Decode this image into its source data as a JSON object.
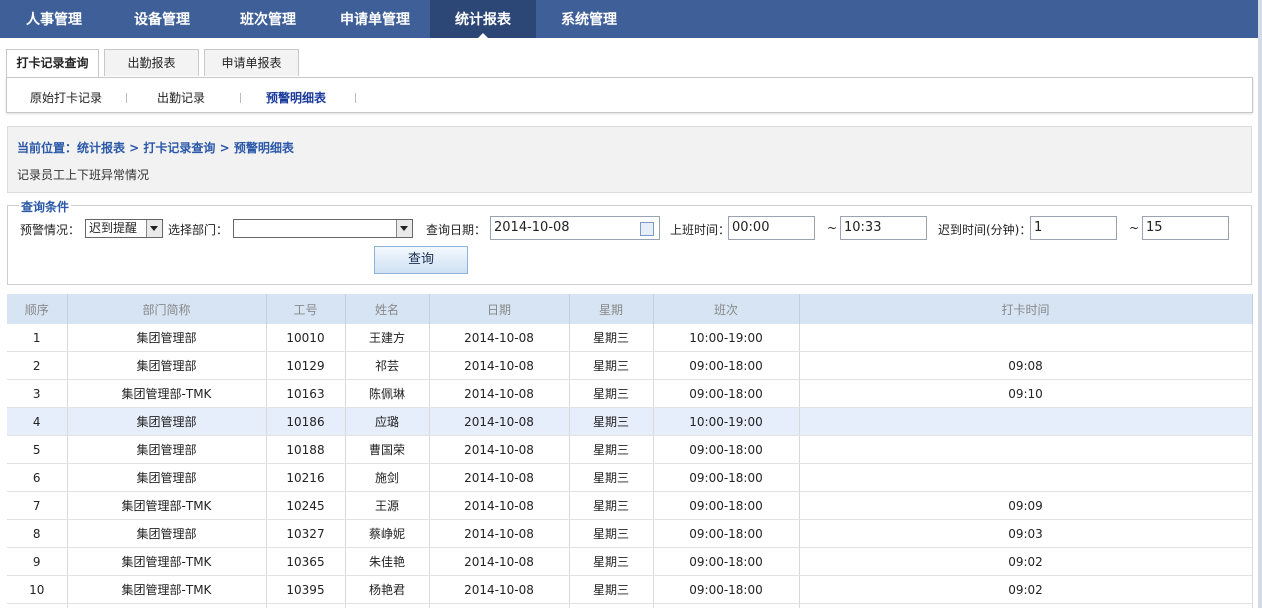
{
  "topnav": [
    "人事管理",
    "设备管理",
    "班次管理",
    "申请单管理",
    "统计报表",
    "系统管理"
  ],
  "subtabs": [
    "打卡记录查询",
    "出勤报表",
    "申请单报表"
  ],
  "subnav": [
    "原始打卡记录",
    "出勤记录",
    "预警明细表"
  ],
  "breadcrumb": "当前位置：统计报表 > 打卡记录查询 > 预警明细表",
  "description": "记录员工上下班异常情况",
  "query": {
    "legend": "查询条件",
    "warn_label": "预警情况：",
    "warn_value": "迟到提醒",
    "dept_label": "选择部门：",
    "dept_value": "",
    "date_label": "查询日期：",
    "date_value": "2014-10-08",
    "work_time_label": "上班时间：",
    "work_time_from": "00:00",
    "tilde": "~",
    "work_time_to": "10:33",
    "late_label": "迟到时间(分钟)：",
    "late_from": "1",
    "late_to": "15",
    "search_button": "查询"
  },
  "table": {
    "headers": [
      "顺序",
      "部门简称",
      "工号",
      "姓名",
      "日期",
      "星期",
      "班次",
      "打卡时间"
    ],
    "rows": [
      [
        "1",
        "集团管理部",
        "10010",
        "王建方",
        "2014-10-08",
        "星期三",
        "10:00-19:00",
        ""
      ],
      [
        "2",
        "集团管理部",
        "10129",
        "祁芸",
        "2014-10-08",
        "星期三",
        "09:00-18:00",
        "09:08"
      ],
      [
        "3",
        "集团管理部-TMK",
        "10163",
        "陈佩琳",
        "2014-10-08",
        "星期三",
        "09:00-18:00",
        "09:10"
      ],
      [
        "4",
        "集团管理部",
        "10186",
        "应璐",
        "2014-10-08",
        "星期三",
        "10:00-19:00",
        ""
      ],
      [
        "5",
        "集团管理部",
        "10188",
        "曹国荣",
        "2014-10-08",
        "星期三",
        "09:00-18:00",
        ""
      ],
      [
        "6",
        "集团管理部",
        "10216",
        "施剑",
        "2014-10-08",
        "星期三",
        "09:00-18:00",
        ""
      ],
      [
        "7",
        "集团管理部-TMK",
        "10245",
        "王源",
        "2014-10-08",
        "星期三",
        "09:00-18:00",
        "09:09"
      ],
      [
        "8",
        "集团管理部",
        "10327",
        "蔡峥妮",
        "2014-10-08",
        "星期三",
        "09:00-18:00",
        "09:03"
      ],
      [
        "9",
        "集团管理部-TMK",
        "10365",
        "朱佳艳",
        "2014-10-08",
        "星期三",
        "09:00-18:00",
        "09:02"
      ],
      [
        "10",
        "集团管理部-TMK",
        "10395",
        "杨艳君",
        "2014-10-08",
        "星期三",
        "09:00-18:00",
        "09:02"
      ]
    ]
  }
}
